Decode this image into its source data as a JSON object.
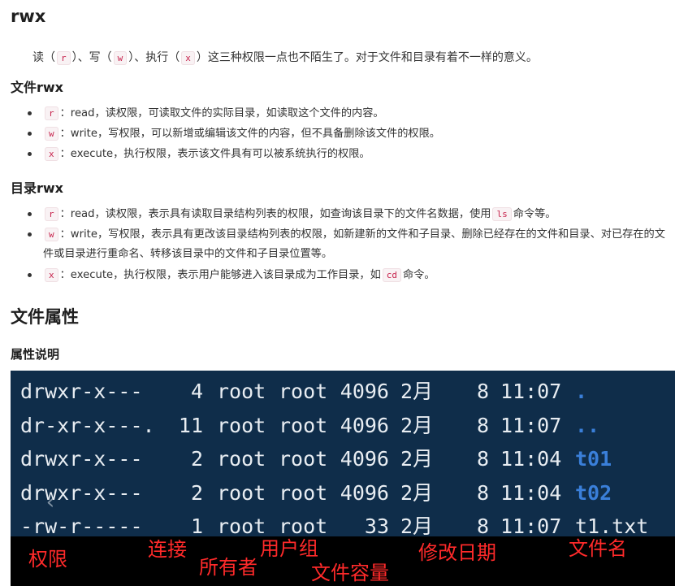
{
  "heading_rwx": "rwx",
  "intro": {
    "p1": "读（",
    "c1": "r",
    "p2": "）、写（",
    "c2": "w",
    "p3": "）、执行（",
    "c3": "x",
    "p4": "）这三种权限一点也不陌生了。对于文件和目录有着不一样的意义。"
  },
  "file_rwx": {
    "heading": "文件rwx",
    "items": [
      {
        "code": "r",
        "text": "：read，读权限，可读取文件的实际目录，如读取这个文件的内容。"
      },
      {
        "code": "w",
        "text": "：write，写权限，可以新增或编辑该文件的内容，但不具备删除该文件的权限。"
      },
      {
        "code": "x",
        "text": "：execute，执行权限，表示该文件具有可以被系统执行的权限。"
      }
    ]
  },
  "dir_rwx": {
    "heading": "目录rwx",
    "item_r": {
      "code": "r",
      "text_before": "：read，读权限，表示具有读取目录结构列表的权限，如查询该目录下的文件名数据，使用",
      "code2": "ls",
      "text_after": "命令等。"
    },
    "item_w": {
      "code": "w",
      "text": "：write，写权限，表示具有更改该目录结构列表的权限，如新建新的文件和子目录、删除已经存在的文件和目录、对已存在的文件或目录进行重命名、转移该目录中的文件和子目录位置等。"
    },
    "item_x": {
      "code": "x",
      "text_before": "：execute，执行权限，表示用户能够进入该目录成为工作目录，如",
      "code2": "cd",
      "text_after": "命令。"
    }
  },
  "attributes": {
    "heading": "文件属性",
    "subheading": "属性说明"
  },
  "terminal": {
    "rows": [
      {
        "perm": "drwxr-x---",
        "links": "4",
        "owner": "root",
        "group": "root",
        "size": "4096",
        "month": "2月",
        "day": "8",
        "time": "11:07",
        "name": ".",
        "is_dir": true
      },
      {
        "perm": "dr-xr-x---.",
        "links": "11",
        "owner": "root",
        "group": "root",
        "size": "4096",
        "month": "2月",
        "day": "8",
        "time": "11:07",
        "name": "..",
        "is_dir": true
      },
      {
        "perm": "drwxr-x---",
        "links": "2",
        "owner": "root",
        "group": "root",
        "size": "4096",
        "month": "2月",
        "day": "8",
        "time": "11:04",
        "name": "t01",
        "is_dir": true
      },
      {
        "perm": "drwxr-x---",
        "links": "2",
        "owner": "root",
        "group": "root",
        "size": "4096",
        "month": "2月",
        "day": "8",
        "time": "11:04",
        "name": "t02",
        "is_dir": true
      },
      {
        "perm": "-rw-r-----",
        "links": "1",
        "owner": "root",
        "group": "root",
        "size": "33",
        "month": "2月",
        "day": "8",
        "time": "11:07",
        "name": "t1.txt",
        "is_dir": false
      }
    ],
    "colors": {
      "background": "#0f2d4a",
      "text": "#e8edf2",
      "dir_name": "#3a7fd9",
      "legend": "#ff2a2a"
    },
    "scroll_icon": "chevron-left-icon"
  },
  "legend": {
    "perm": "权限",
    "links": "连接",
    "owner": "所有者",
    "group": "用户组",
    "size": "文件容量",
    "date": "修改日期",
    "name": "文件名"
  }
}
